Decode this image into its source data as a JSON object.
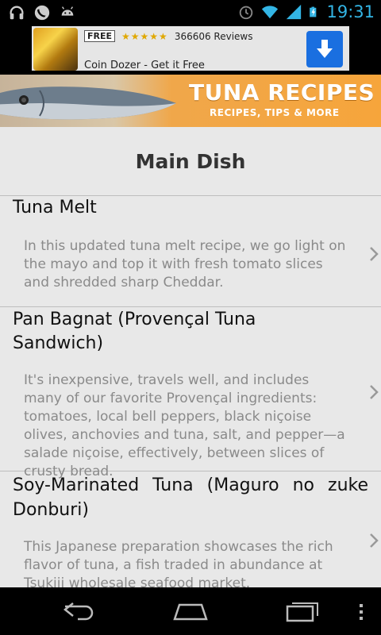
{
  "status_bar": {
    "time": "19:31",
    "icons_left": [
      "headphones-icon",
      "call-icon",
      "android-icon"
    ],
    "icons_right": [
      "alarm-icon",
      "wifi-icon",
      "signal-icon",
      "battery-charging-icon"
    ]
  },
  "ad": {
    "free_label": "FREE",
    "rating_stars": "★★★★★",
    "reviews": "366606 Reviews",
    "title": "Coin Dozer - Get it Free"
  },
  "banner": {
    "title": "TUNA RECIPES",
    "subtitle": "RECIPES, TIPS & MORE"
  },
  "section": {
    "title": "Main Dish"
  },
  "recipes": [
    {
      "title": "Tuna Melt",
      "description": "In this updated tuna melt recipe, we go light on the mayo and top it with fresh tomato slices and shredded sharp Cheddar."
    },
    {
      "title": "Pan Bagnat (Provençal Tuna Sandwich)",
      "description": "It's inexpensive, travels well, and includes many of our favorite Provençal ingredients: tomatoes, local bell peppers, black niçoise olives, anchovies and tuna, salt, and pepper—a salade niçoise, effectively, between slices of crusty bread."
    },
    {
      "title": "Soy-Marinated Tuna (Maguro no zuke Donburi)",
      "description": "This Japanese preparation showcases the rich flavor of tuna, a fish traded in abundance at Tsukiji wholesale seafood market."
    }
  ],
  "colors": {
    "clock": "#33b5e5",
    "banner_orange": "#f6a53b",
    "list_bg": "#e8e8e8"
  }
}
